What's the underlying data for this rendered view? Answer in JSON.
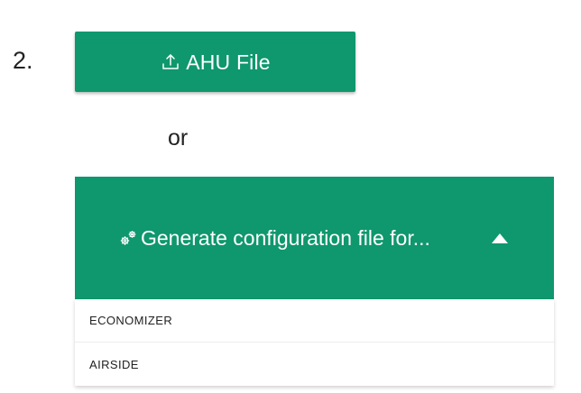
{
  "step": {
    "number": "2."
  },
  "upload_button": {
    "label": "AHU File",
    "icon": "upload-icon"
  },
  "separator": {
    "text": "or"
  },
  "generate_button": {
    "label": "Generate configuration file for...",
    "icon": "gears-icon",
    "caret_icon": "caret-up-icon",
    "expanded": true
  },
  "menu": {
    "items": [
      {
        "label": "ECONOMIZER"
      },
      {
        "label": "AIRSIDE"
      }
    ]
  },
  "colors": {
    "accent": "#0f976d",
    "text": "#222222",
    "menu_background": "#ffffff"
  }
}
